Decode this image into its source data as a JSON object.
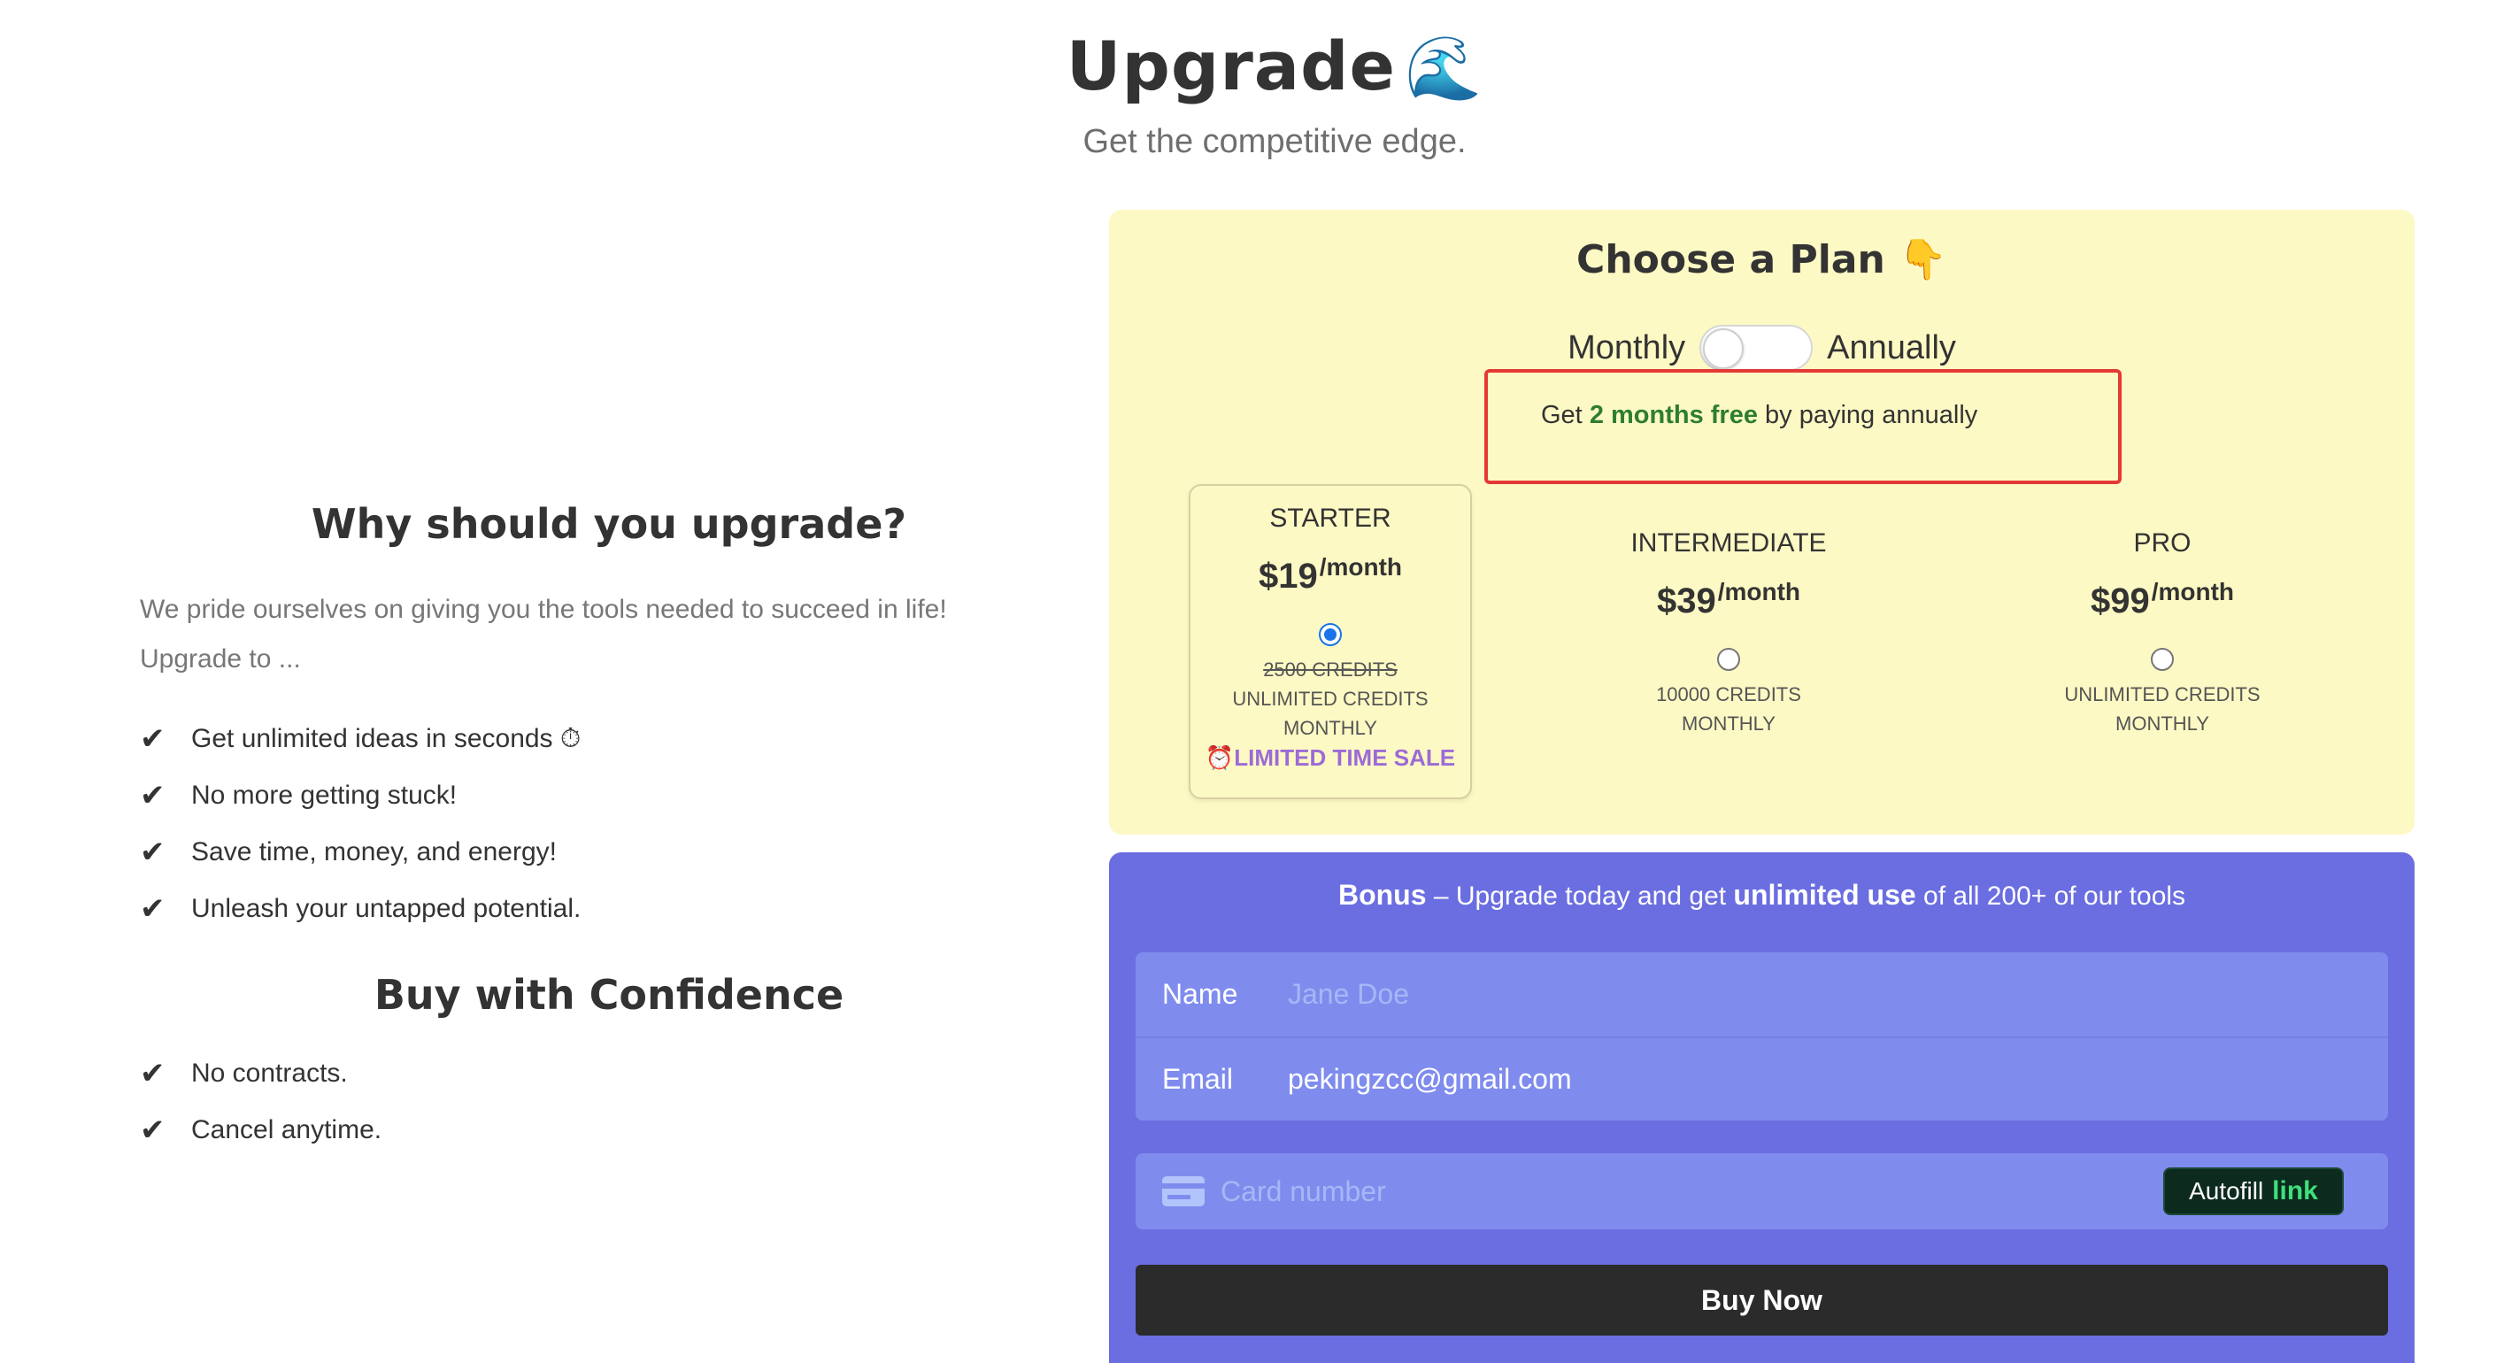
{
  "header": {
    "title": "Upgrade",
    "title_emoji": "🌊",
    "subtitle": "Get the competitive edge."
  },
  "why": {
    "heading": "Why should you upgrade?",
    "intro": "We pride ourselves on giving you the tools needed to succeed in life!",
    "upgrade_to": "Upgrade to ...",
    "benefits": [
      "Get unlimited ideas in seconds ⏱",
      "No more getting stuck!",
      "Save time, money, and energy!",
      "Unleash your untapped potential."
    ]
  },
  "confidence": {
    "heading": "Buy with Confidence",
    "items": [
      "No contracts.",
      "Cancel anytime."
    ]
  },
  "plan_panel": {
    "title": "Choose a Plan 👇",
    "toggle_left": "Monthly",
    "toggle_right": "Annually",
    "toggle_state": "Monthly",
    "promo_prefix": "Get ",
    "promo_highlight": "2 months free",
    "promo_suffix": " by paying annually",
    "plans": [
      {
        "name": "STARTER",
        "price": "$19",
        "period": "/month",
        "selected": true,
        "old_credits": "2500 CREDITS",
        "credits": "UNLIMITED CREDITS",
        "frequency": "MONTHLY",
        "sale": "⏰LIMITED TIME SALE"
      },
      {
        "name": "INTERMEDIATE",
        "price": "$39",
        "period": "/month",
        "selected": false,
        "credits": "10000 CREDITS",
        "frequency": "MONTHLY"
      },
      {
        "name": "PRO",
        "price": "$99",
        "period": "/month",
        "selected": false,
        "credits": "UNLIMITED CREDITS",
        "frequency": "MONTHLY"
      }
    ]
  },
  "checkout": {
    "bonus_bold": "Bonus",
    "bonus_mid": " – Upgrade today and get ",
    "bonus_bold2": "unlimited use",
    "bonus_end": " of all 200+ of our tools",
    "name_label": "Name",
    "name_placeholder": "Jane Doe",
    "email_label": "Email",
    "email_value": "pekingzcc@gmail.com",
    "card_placeholder": "Card number",
    "autofill_label": "Autofill",
    "autofill_link": "link",
    "buy_label": "Buy Now"
  },
  "colors": {
    "plan_panel_bg": "#fdf9c4",
    "checkout_bg": "#6b6ee0",
    "promo_border": "#e53935",
    "promo_highlight": "#2e7d32",
    "sale": "#9c6bd6",
    "buy_button": "#2b2b2b"
  }
}
